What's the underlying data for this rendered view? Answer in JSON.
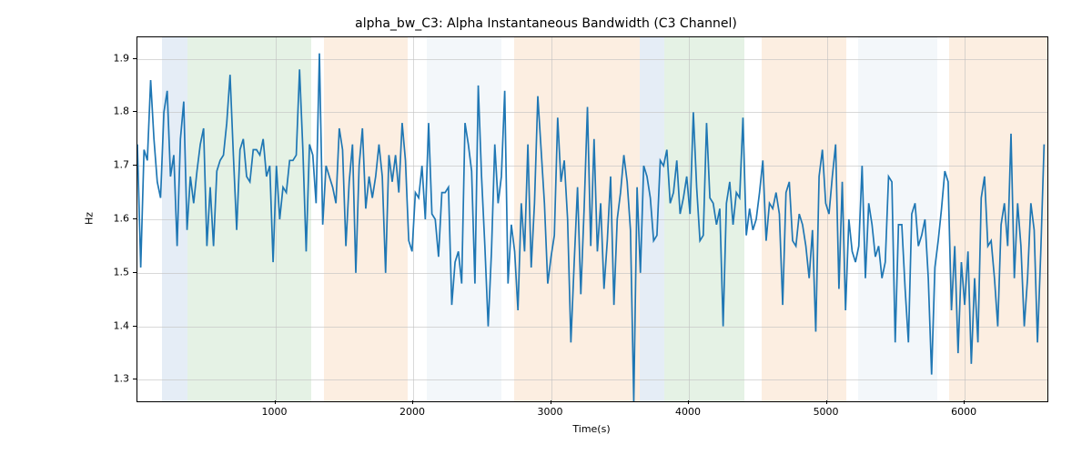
{
  "chart_data": {
    "type": "line",
    "title": "alpha_bw_C3: Alpha Instantaneous Bandwidth (C3 Channel)",
    "xlabel": "Time(s)",
    "ylabel": "Hz",
    "xlim": [
      0,
      6600
    ],
    "ylim": [
      1.26,
      1.94
    ],
    "x_ticks": [
      1000,
      2000,
      3000,
      4000,
      5000,
      6000
    ],
    "y_ticks": [
      1.3,
      1.4,
      1.5,
      1.6,
      1.7,
      1.8,
      1.9
    ],
    "bands": [
      {
        "x0": 180,
        "x1": 360,
        "color": "blue"
      },
      {
        "x0": 360,
        "x1": 1260,
        "color": "green"
      },
      {
        "x0": 1350,
        "x1": 1960,
        "color": "orange"
      },
      {
        "x0": 2100,
        "x1": 2640,
        "color": "lightblue"
      },
      {
        "x0": 2730,
        "x1": 2900,
        "color": "orange"
      },
      {
        "x0": 2900,
        "x1": 3640,
        "color": "orange"
      },
      {
        "x0": 3640,
        "x1": 3820,
        "color": "blue"
      },
      {
        "x0": 3820,
        "x1": 4400,
        "color": "green"
      },
      {
        "x0": 4530,
        "x1": 5140,
        "color": "orange"
      },
      {
        "x0": 5230,
        "x1": 5800,
        "color": "lightblue"
      },
      {
        "x0": 5890,
        "x1": 5960,
        "color": "orange"
      },
      {
        "x0": 5960,
        "x1": 6600,
        "color": "orange"
      }
    ],
    "series": [
      {
        "name": "alpha_bw_C3",
        "color": "#1f77b4",
        "x_step": 24,
        "values": [
          1.74,
          1.51,
          1.73,
          1.71,
          1.86,
          1.75,
          1.67,
          1.64,
          1.8,
          1.84,
          1.68,
          1.72,
          1.55,
          1.75,
          1.82,
          1.58,
          1.68,
          1.63,
          1.69,
          1.74,
          1.77,
          1.55,
          1.66,
          1.55,
          1.69,
          1.71,
          1.72,
          1.78,
          1.87,
          1.72,
          1.58,
          1.73,
          1.75,
          1.68,
          1.67,
          1.73,
          1.73,
          1.72,
          1.75,
          1.68,
          1.7,
          1.52,
          1.7,
          1.6,
          1.66,
          1.65,
          1.71,
          1.71,
          1.72,
          1.88,
          1.73,
          1.54,
          1.74,
          1.72,
          1.63,
          1.91,
          1.59,
          1.7,
          1.68,
          1.66,
          1.63,
          1.77,
          1.73,
          1.55,
          1.67,
          1.74,
          1.5,
          1.7,
          1.77,
          1.62,
          1.68,
          1.64,
          1.68,
          1.74,
          1.68,
          1.5,
          1.72,
          1.67,
          1.72,
          1.65,
          1.78,
          1.71,
          1.56,
          1.54,
          1.65,
          1.64,
          1.7,
          1.6,
          1.78,
          1.61,
          1.6,
          1.53,
          1.65,
          1.65,
          1.66,
          1.44,
          1.52,
          1.54,
          1.48,
          1.78,
          1.74,
          1.69,
          1.48,
          1.85,
          1.68,
          1.55,
          1.4,
          1.54,
          1.74,
          1.63,
          1.68,
          1.84,
          1.48,
          1.59,
          1.54,
          1.43,
          1.63,
          1.54,
          1.74,
          1.51,
          1.63,
          1.83,
          1.73,
          1.63,
          1.48,
          1.53,
          1.57,
          1.79,
          1.67,
          1.71,
          1.6,
          1.37,
          1.52,
          1.66,
          1.46,
          1.62,
          1.81,
          1.55,
          1.75,
          1.54,
          1.63,
          1.47,
          1.56,
          1.68,
          1.44,
          1.6,
          1.65,
          1.72,
          1.67,
          1.58,
          1.26,
          1.66,
          1.5,
          1.7,
          1.68,
          1.64,
          1.56,
          1.57,
          1.71,
          1.7,
          1.73,
          1.63,
          1.65,
          1.71,
          1.61,
          1.64,
          1.68,
          1.61,
          1.8,
          1.66,
          1.56,
          1.57,
          1.78,
          1.64,
          1.63,
          1.59,
          1.62,
          1.4,
          1.63,
          1.67,
          1.59,
          1.65,
          1.64,
          1.79,
          1.57,
          1.62,
          1.58,
          1.6,
          1.65,
          1.71,
          1.56,
          1.63,
          1.62,
          1.65,
          1.61,
          1.44,
          1.65,
          1.67,
          1.56,
          1.55,
          1.61,
          1.59,
          1.55,
          1.49,
          1.58,
          1.39,
          1.68,
          1.73,
          1.63,
          1.61,
          1.68,
          1.74,
          1.47,
          1.67,
          1.43,
          1.6,
          1.54,
          1.52,
          1.55,
          1.7,
          1.49,
          1.63,
          1.59,
          1.53,
          1.55,
          1.49,
          1.52,
          1.68,
          1.67,
          1.37,
          1.59,
          1.59,
          1.47,
          1.37,
          1.61,
          1.63,
          1.55,
          1.57,
          1.6,
          1.49,
          1.31,
          1.51,
          1.56,
          1.62,
          1.69,
          1.67,
          1.43,
          1.55,
          1.35,
          1.52,
          1.44,
          1.54,
          1.33,
          1.49,
          1.37,
          1.64,
          1.68,
          1.55,
          1.56,
          1.49,
          1.4,
          1.59,
          1.63,
          1.55,
          1.76,
          1.49,
          1.63,
          1.55,
          1.4,
          1.49,
          1.63,
          1.58,
          1.37,
          1.54,
          1.74
        ]
      }
    ]
  }
}
